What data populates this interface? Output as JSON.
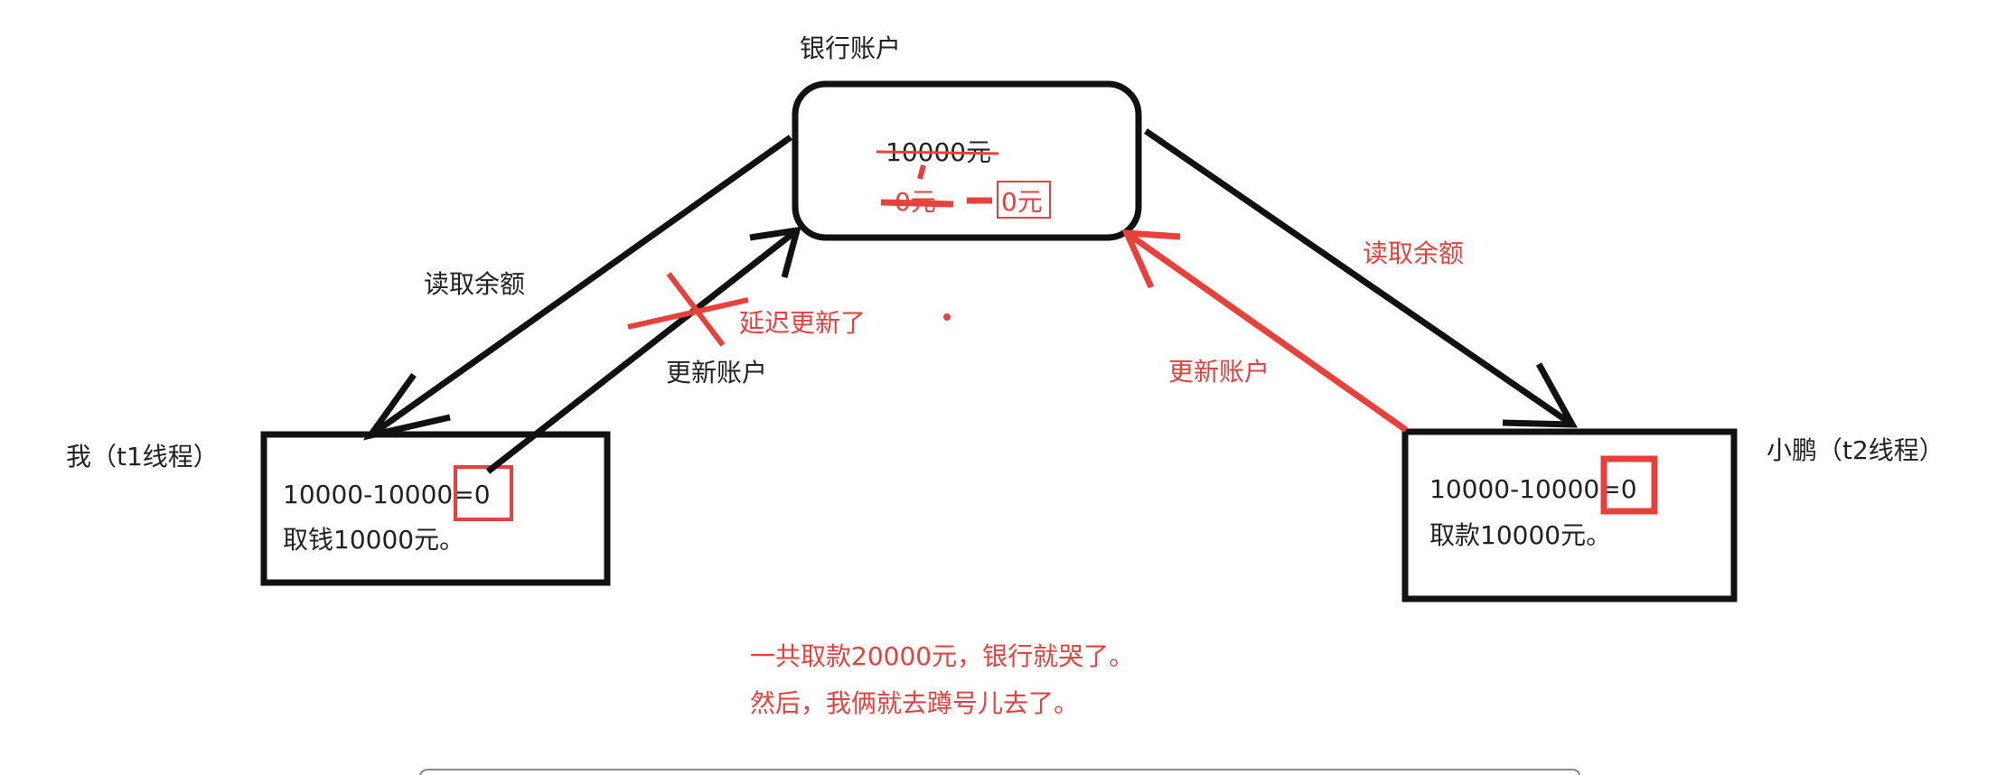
{
  "bank": {
    "title": "银行账户",
    "old_balance": "10000元",
    "struck_value": "0元",
    "new_balance": "0元"
  },
  "t1": {
    "name": "我（t1线程）",
    "calc": "10000-10000=",
    "result": "0",
    "action": "取钱10000元。"
  },
  "t2": {
    "name": "小鹏（t2线程）",
    "calc": "10000-10000=",
    "result": "0",
    "action": "取款10000元。"
  },
  "arrows": {
    "left_read": "读取余额",
    "left_update": "更新账户",
    "delayed": "延迟更新了",
    "right_read": "读取余额",
    "right_update": "更新账户"
  },
  "conclusion": {
    "line1": "一共取款20000元，银行就哭了。",
    "line2": "然后，我俩就去蹲号儿去了。"
  },
  "colors": {
    "ink": "#111111",
    "annotation": "#e8413c"
  }
}
